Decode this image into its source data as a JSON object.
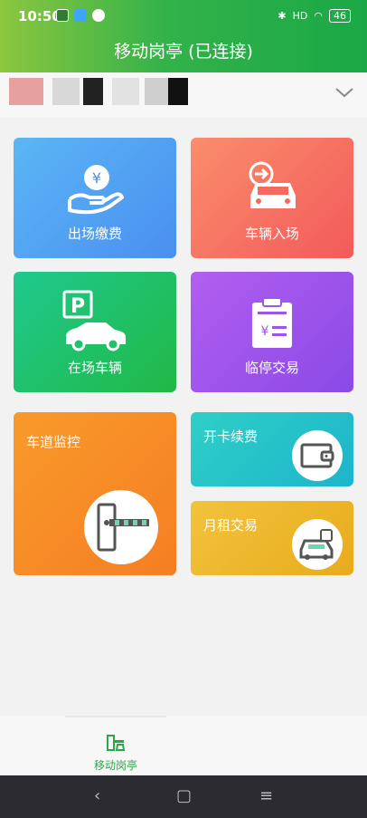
{
  "status_bar": {
    "time": "10:50",
    "signal": "HD",
    "battery": "46"
  },
  "app": {
    "title": "移动岗亭 (已连接)"
  },
  "tiles": {
    "pay": "出场缴费",
    "entry": "车辆入场",
    "onsite": "在场车辆",
    "temp": "临停交易",
    "lane": "车道监控",
    "card": "开卡续费",
    "month": "月租交易"
  },
  "tabbar": {
    "home": "移动岗亭"
  },
  "colors": {
    "header_green": "#33b24a",
    "tab_active": "#2aa846"
  }
}
